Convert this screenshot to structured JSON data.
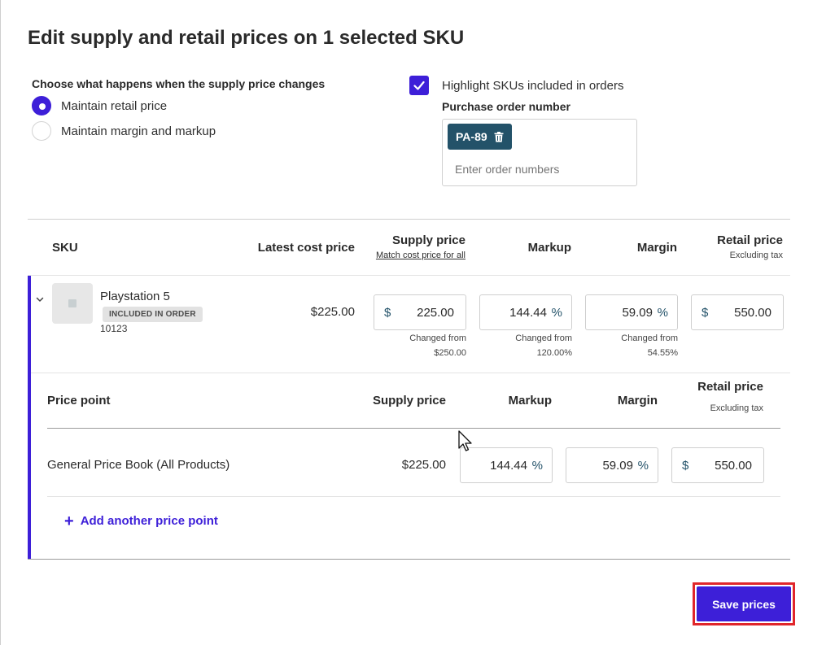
{
  "title": "Edit supply and retail prices on 1 selected SKU",
  "supply_change": {
    "label": "Choose what happens when the supply price changes",
    "options": [
      {
        "label": "Maintain retail price",
        "checked": true
      },
      {
        "label": "Maintain margin and markup",
        "checked": false
      }
    ]
  },
  "highlight": {
    "label": "Highlight SKUs included in orders",
    "checked": true
  },
  "po": {
    "label": "Purchase order number",
    "chip": "PA-89",
    "placeholder": "Enter order numbers"
  },
  "table_headers": {
    "sku": "SKU",
    "latest_cost": "Latest cost price",
    "supply": "Supply price",
    "supply_link": "Match cost price for all",
    "markup": "Markup",
    "margin": "Margin",
    "retail": "Retail price",
    "retail_sub": "Excluding tax"
  },
  "product": {
    "name": "Playstation 5",
    "badge": "INCLUDED IN ORDER",
    "code": "10123",
    "latest_cost": "$225.00",
    "supply": {
      "prefix": "$",
      "value": "225.00",
      "changed_label": "Changed from",
      "changed_value": "$250.00"
    },
    "markup": {
      "value": "144.44",
      "suffix": "%",
      "changed_label": "Changed from",
      "changed_value": "120.00%"
    },
    "margin": {
      "value": "59.09",
      "suffix": "%",
      "changed_label": "Changed from",
      "changed_value": "54.55%"
    },
    "retail": {
      "prefix": "$",
      "value": "550.00"
    }
  },
  "price_point_headers": {
    "name": "Price point",
    "supply": "Supply price",
    "markup": "Markup",
    "margin": "Margin",
    "retail": "Retail price",
    "retail_sub": "Excluding tax"
  },
  "price_points": [
    {
      "name": "General Price Book (All Products)",
      "supply": "$225.00",
      "markup": "144.44",
      "markup_suffix": "%",
      "margin": "59.09",
      "margin_suffix": "%",
      "retail_prefix": "$",
      "retail": "550.00"
    }
  ],
  "add_price_point": {
    "icon": "+",
    "label": "Add another price point"
  },
  "save_button": "Save prices",
  "colors": {
    "accent": "#3d1fd8",
    "chip": "#235269",
    "highlight_outline": "#e0262b"
  }
}
